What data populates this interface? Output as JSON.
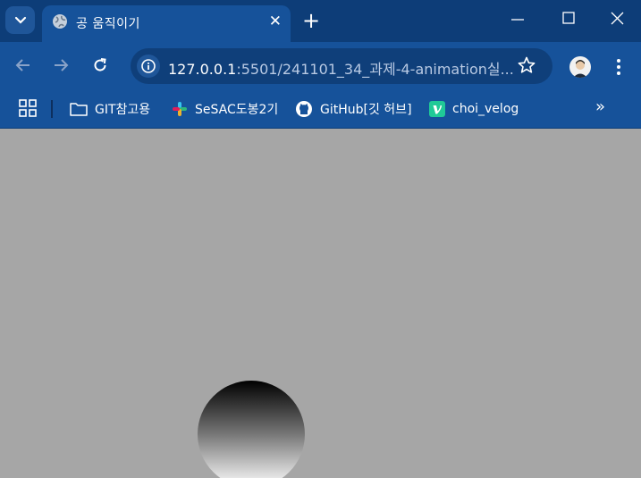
{
  "browser": {
    "tab": {
      "title": "공 움직이기",
      "icon": "globe-icon"
    },
    "address": {
      "host": "127.0.0.1",
      "path": ":5501/241101_34_과제-4-animation실..."
    },
    "bookmarks": [
      {
        "label": "GIT참고용",
        "icon": "folder-icon"
      },
      {
        "label": "SeSAC도봉2기",
        "icon": "slack-icon"
      },
      {
        "label": "GitHub[깃 허브]",
        "icon": "github-icon"
      },
      {
        "label": "choi_velog",
        "icon": "velog-icon"
      }
    ],
    "colors": {
      "titlebar": "#0d3d78",
      "toolbar": "#16529a",
      "viewport_background": "#a6a6a6"
    }
  },
  "page": {
    "ball": {
      "gradient": [
        "#000000",
        "#ffffff"
      ]
    }
  }
}
